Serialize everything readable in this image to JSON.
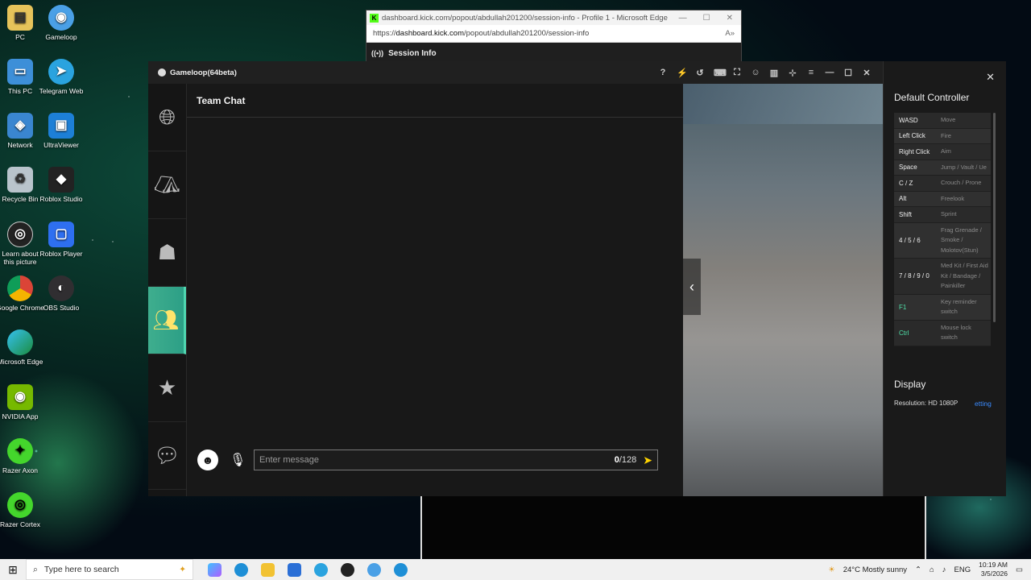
{
  "desktop": {
    "icons": [
      {
        "label": "PC",
        "x": 0,
        "y": 0
      },
      {
        "label": "Gameloop"
      },
      {
        "label": "This PC"
      },
      {
        "label": "Telegram Web"
      },
      {
        "label": "Network"
      },
      {
        "label": "UltraViewer"
      },
      {
        "label": "Recycle Bin"
      },
      {
        "label": "Roblox Studio"
      },
      {
        "label": "Learn about this picture"
      },
      {
        "label": "Roblox Player"
      },
      {
        "label": "Google Chrome"
      },
      {
        "label": "OBS Studio"
      },
      {
        "label": "Microsoft Edge"
      },
      {
        "label": "NVIDIA App"
      },
      {
        "label": "Razer Axon"
      },
      {
        "label": "Razer Cortex"
      }
    ]
  },
  "edge": {
    "title": "dashboard.kick.com/popout/abdullah201200/session-info - Profile 1 - Microsoft Edge",
    "url_prefix": "https://",
    "url_domain": "dashboard.kick.com",
    "url_path": "/popout/abdullah201200/session-info",
    "session_label": "Session Info"
  },
  "gameloop": {
    "title": "Gameloop(64beta)",
    "chat": {
      "header": "Team Chat",
      "placeholder": "Enter message",
      "count_current": "0",
      "count_max": "/128"
    }
  },
  "controller": {
    "title": "Default Controller",
    "rows": [
      {
        "key": "WASD",
        "action": "Move"
      },
      {
        "key": "Left Click",
        "action": "Fire"
      },
      {
        "key": "Right Click",
        "action": "Aim"
      },
      {
        "key": "Space",
        "action": "Jump / Vault / Ue"
      },
      {
        "key": "C / Z",
        "action": "Crouch / Prone"
      },
      {
        "key": "Alt",
        "action": "Freelook"
      },
      {
        "key": "Shift",
        "action": "Sprint"
      },
      {
        "key": "4 / 5 / 6",
        "action": "Frag Grenade / Smoke / Molotov(Stun)"
      },
      {
        "key": "7 / 8 / 9 / 0",
        "action": "Med Kit / First Aid Kit / Bandage / Painkiller"
      },
      {
        "key": "F1",
        "action": "Key reminder switch"
      },
      {
        "key": "Ctrl",
        "action": "Mouse lock switch"
      }
    ],
    "display_title": "Display",
    "resolution": "Resolution: HD 1080P",
    "settings_link": "etting"
  },
  "taskbar": {
    "search_placeholder": "Type here to search",
    "weather": "24°C  Mostly sunny",
    "lang": "ENG",
    "time": "10:19 AM",
    "date": "3/5/2026"
  }
}
